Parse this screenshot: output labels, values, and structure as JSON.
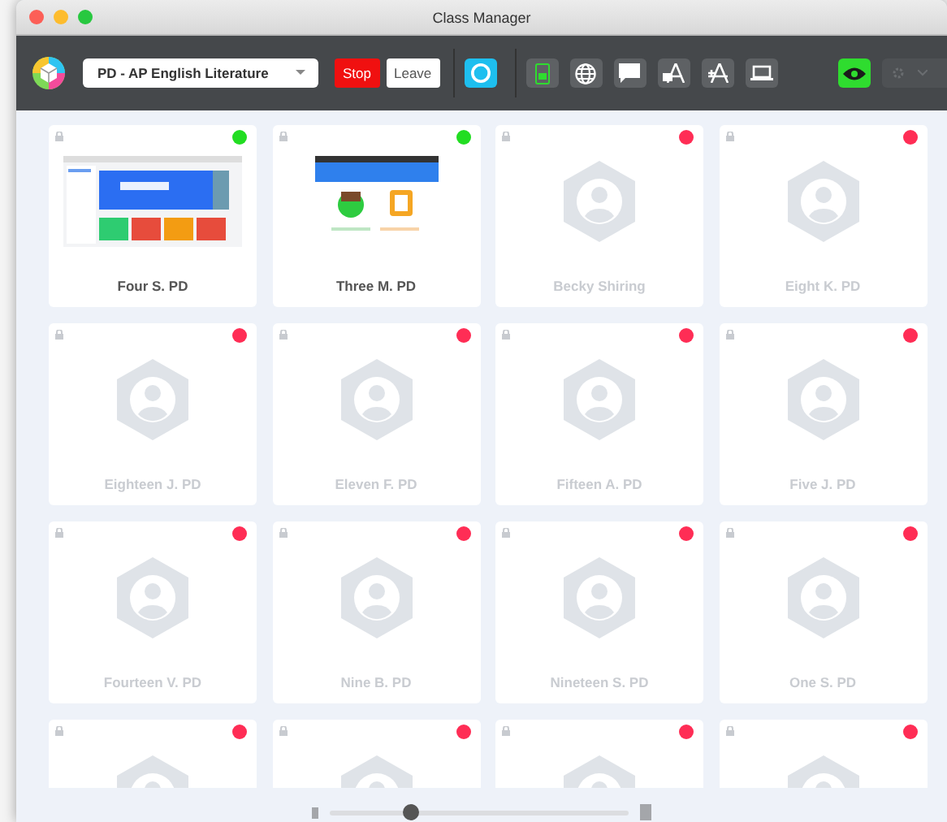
{
  "window": {
    "title": "Class Manager"
  },
  "toolbar": {
    "class_select": {
      "value": "PD - AP English Literature"
    },
    "buttons": [
      {
        "label": "Stop",
        "kind": "danger"
      },
      {
        "label": "Leave",
        "kind": "plain"
      }
    ],
    "focus_on": true,
    "settings_disabled": true
  },
  "tiles": [
    {
      "name": "Four S. PD",
      "kind": "screen",
      "color": "#22dd22"
    },
    {
      "name": "Three M. PD",
      "kind": "screen",
      "color": "#22dd22"
    },
    {
      "name": "Becky Shiring",
      "kind": "avatar",
      "color": "#ff2d55"
    },
    {
      "name": "Eight K. PD",
      "kind": "avatar",
      "color": "#ff2d55"
    },
    {
      "name": "Eighteen J. PD",
      "kind": "avatar",
      "color": "#ff2d55"
    },
    {
      "name": "Eleven F. PD",
      "kind": "avatar",
      "color": "#ff2d55"
    },
    {
      "name": "Fifteen A. PD",
      "kind": "avatar",
      "color": "#ff2d55"
    },
    {
      "name": "Five J. PD",
      "kind": "avatar",
      "color": "#ff2d55"
    },
    {
      "name": "Fourteen V. PD",
      "kind": "avatar",
      "color": "#ff2d55"
    },
    {
      "name": "Nine B. PD",
      "kind": "avatar",
      "color": "#ff2d55"
    },
    {
      "name": "Nineteen S. PD",
      "kind": "avatar",
      "color": "#ff2d55"
    },
    {
      "name": "One S. PD",
      "kind": "avatar",
      "color": "#ff2d55"
    },
    {
      "kind": "avatar",
      "color": "#ff2d55"
    },
    {
      "kind": "avatar",
      "color": "#ff2d55"
    },
    {
      "kind": "avatar",
      "color": "#ff2d55"
    },
    {
      "kind": "avatar",
      "color": "#ff2d55"
    }
  ],
  "zoom_slider": {
    "level": 0.27
  }
}
